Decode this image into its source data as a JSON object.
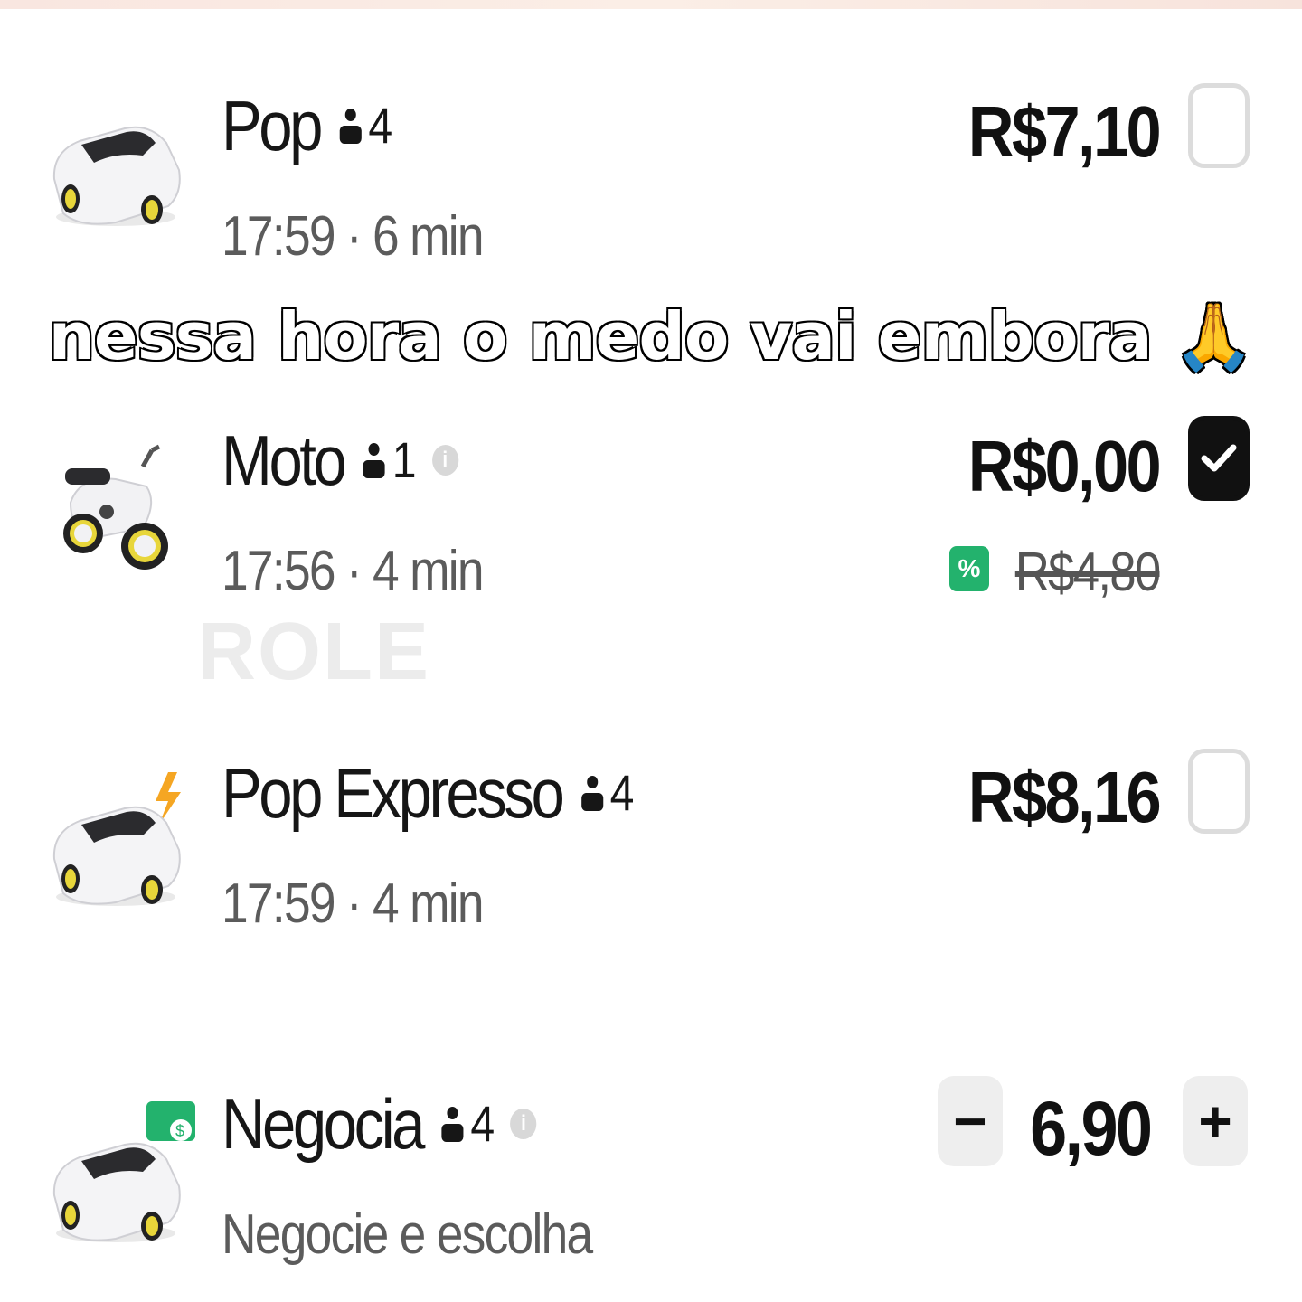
{
  "caption": "nessa hora o medo vai embora 🙏",
  "watermark": "ROLE",
  "options": [
    {
      "name": "Pop",
      "seats": "4",
      "time": "17:59 · 6 min",
      "price": "R$7,10",
      "selected": false,
      "icon": "car-icon"
    },
    {
      "name": "Moto",
      "seats": "1",
      "time": "17:56 · 4 min",
      "price": "R$0,00",
      "old_price": "R$4,80",
      "selected": true,
      "icon": "motorcycle-icon",
      "badge": "%"
    },
    {
      "name": "Pop Expresso",
      "seats": "4",
      "time": "17:59 · 4 min",
      "price": "R$8,16",
      "selected": false,
      "icon": "car-lightning-icon"
    },
    {
      "name": "Negocia",
      "seats": "4",
      "subtitle": "Negocie e escolha",
      "stepper": {
        "minus": "−",
        "value": "6,90",
        "plus": "+"
      },
      "icon": "car-negotiate-icon"
    }
  ],
  "colors": {
    "accent_green": "#23b26d",
    "check_black": "#111111"
  }
}
